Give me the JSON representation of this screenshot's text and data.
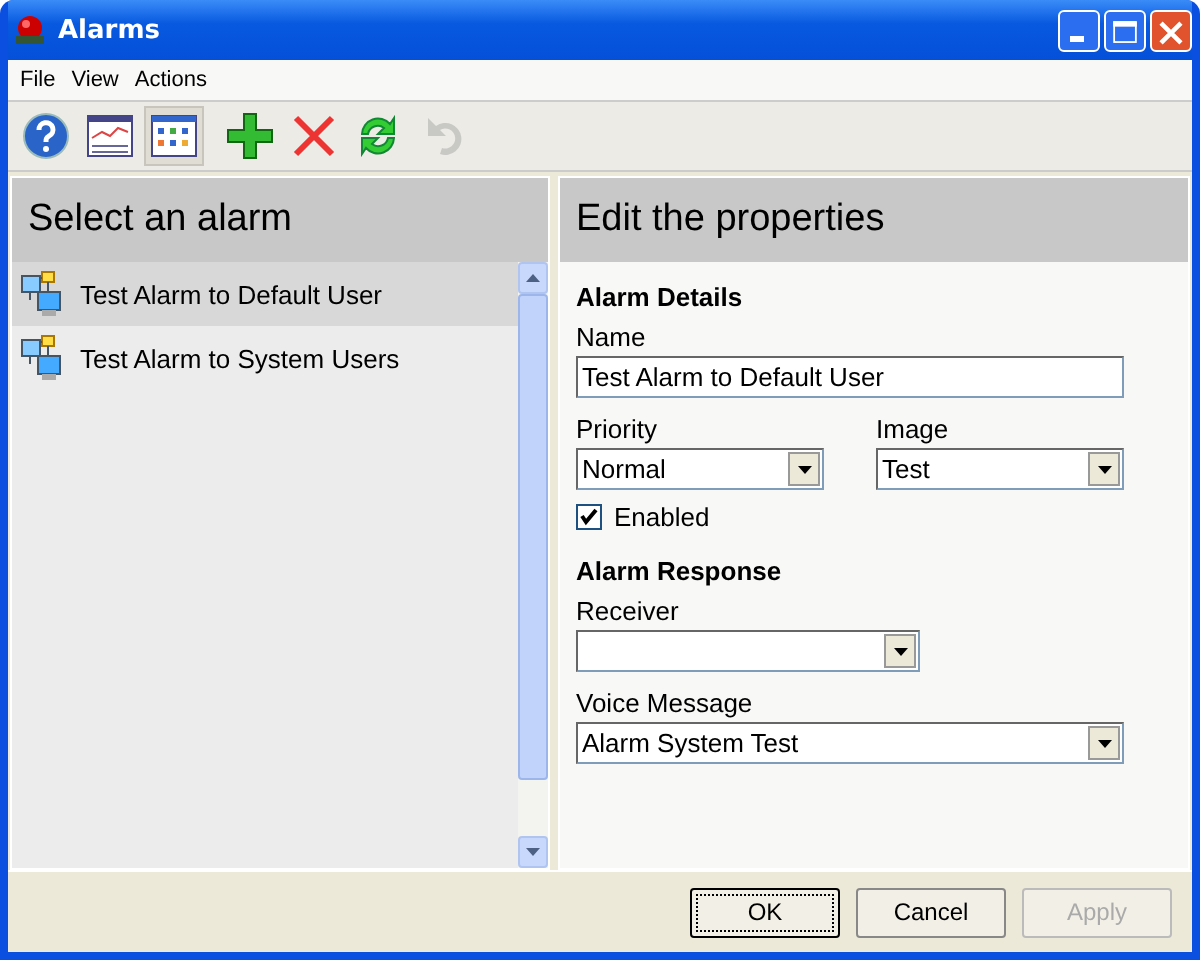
{
  "window": {
    "title": "Alarms"
  },
  "menu": [
    "File",
    "View",
    "Actions"
  ],
  "toolbar": [
    {
      "kind": "help",
      "selected": false,
      "disabled": false
    },
    {
      "kind": "chart",
      "selected": false,
      "disabled": false
    },
    {
      "kind": "grid",
      "selected": true,
      "disabled": false
    },
    {
      "kind": "add",
      "selected": false,
      "disabled": false
    },
    {
      "kind": "delete",
      "selected": false,
      "disabled": false
    },
    {
      "kind": "refresh",
      "selected": false,
      "disabled": false
    },
    {
      "kind": "undo",
      "selected": false,
      "disabled": true
    }
  ],
  "alarm_list": {
    "heading": "Select an alarm",
    "items": [
      {
        "label": "Test Alarm to Default User",
        "selected": true
      },
      {
        "label": "Test Alarm to System Users",
        "selected": false
      }
    ]
  },
  "properties": {
    "heading": "Edit the properties",
    "details_heading": "Alarm Details",
    "name_label": "Name",
    "name_value": "Test Alarm to Default User",
    "priority_label": "Priority",
    "priority_value": "Normal",
    "image_label": "Image",
    "image_value": "Test",
    "enabled_label": "Enabled",
    "enabled": true,
    "response_heading": "Alarm Response",
    "receiver_label": "Receiver",
    "voice_label": "Voice Message",
    "voice_value": "Alarm System Test"
  },
  "buttons": [
    {
      "label": "OK",
      "disabled": false,
      "default": true
    },
    {
      "label": "Cancel",
      "disabled": false,
      "default": false
    },
    {
      "label": "Apply",
      "disabled": true,
      "default": false
    }
  ]
}
